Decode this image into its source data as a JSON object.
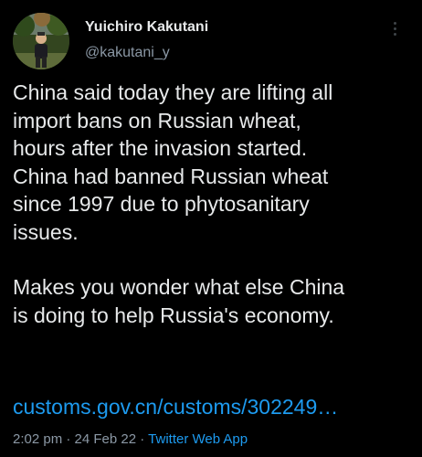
{
  "author": {
    "display_name": "Yuichiro Kakutani",
    "handle": "@kakutani_y"
  },
  "tweet": {
    "paragraph_1_lines": [
      "China said today they are lifting all",
      "import bans on Russian wheat,",
      "hours after the invasion started.",
      "China had banned Russian wheat",
      "since 1997 due to phytosanitary",
      "issues."
    ],
    "paragraph_2_lines": [
      "Makes you wonder what else China",
      "is doing to help Russia's economy."
    ],
    "link_text": "customs.gov.cn/customs/302249…"
  },
  "meta": {
    "time": "2:02 pm",
    "separator": " · ",
    "date": "24 Feb 22",
    "source_app": "Twitter Web App"
  },
  "icons": {
    "more": "more-vertical-icon"
  },
  "colors": {
    "background": "#000000",
    "text": "#e7e9ea",
    "secondary": "#8b98a5",
    "accent": "#1d9bf0"
  }
}
